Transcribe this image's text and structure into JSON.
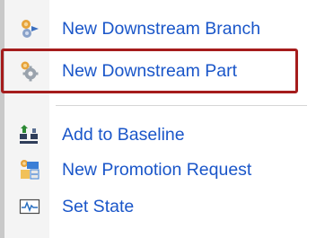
{
  "menu": {
    "items": [
      {
        "label": "New Downstream Branch",
        "icon": "downstream-branch-icon"
      },
      {
        "label": "New Downstream Part",
        "icon": "downstream-part-gear-icon"
      },
      {
        "label": "Add to Baseline",
        "icon": "baseline-icon"
      },
      {
        "label": "New Promotion Request",
        "icon": "promotion-request-icon"
      },
      {
        "label": "Set State",
        "icon": "set-state-icon"
      }
    ],
    "highlighted_item": "New Downstream Part"
  },
  "colors": {
    "label": "#1a56c9",
    "highlight_border": "#a51c1c",
    "gutter": "#f4f4f4"
  }
}
